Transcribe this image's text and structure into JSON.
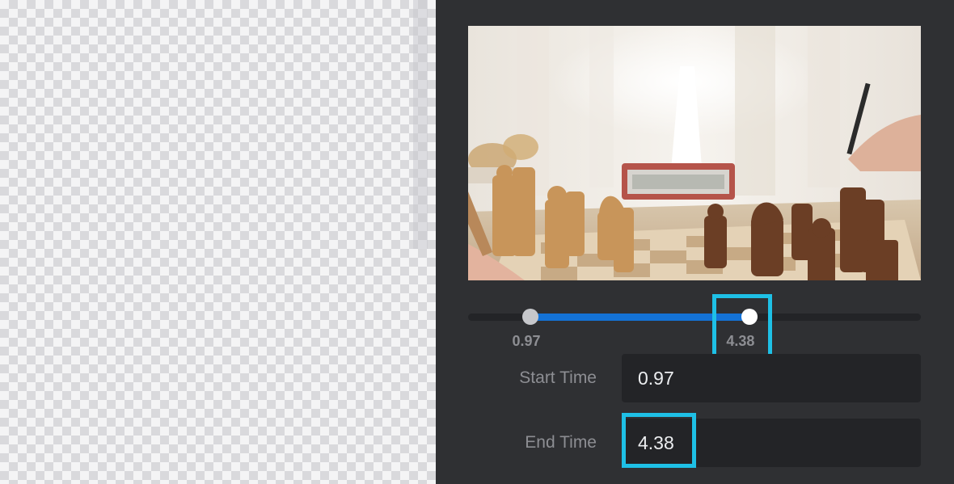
{
  "trim_panel": {
    "preview_image": "chess-board-photo",
    "slider": {
      "min": 0,
      "max": 7.05,
      "start_value": 0.97,
      "end_value": 4.38,
      "start_label": "0.97",
      "end_label": "4.38"
    },
    "start_time": {
      "label": "Start Time",
      "value": "0.97"
    },
    "end_time": {
      "label": "End Time",
      "value": "4.38"
    }
  },
  "colors": {
    "panel_bg": "#2f3033",
    "field_bg": "#232427",
    "accent_fill": "#1472d6",
    "highlight": "#1ec0e6"
  }
}
